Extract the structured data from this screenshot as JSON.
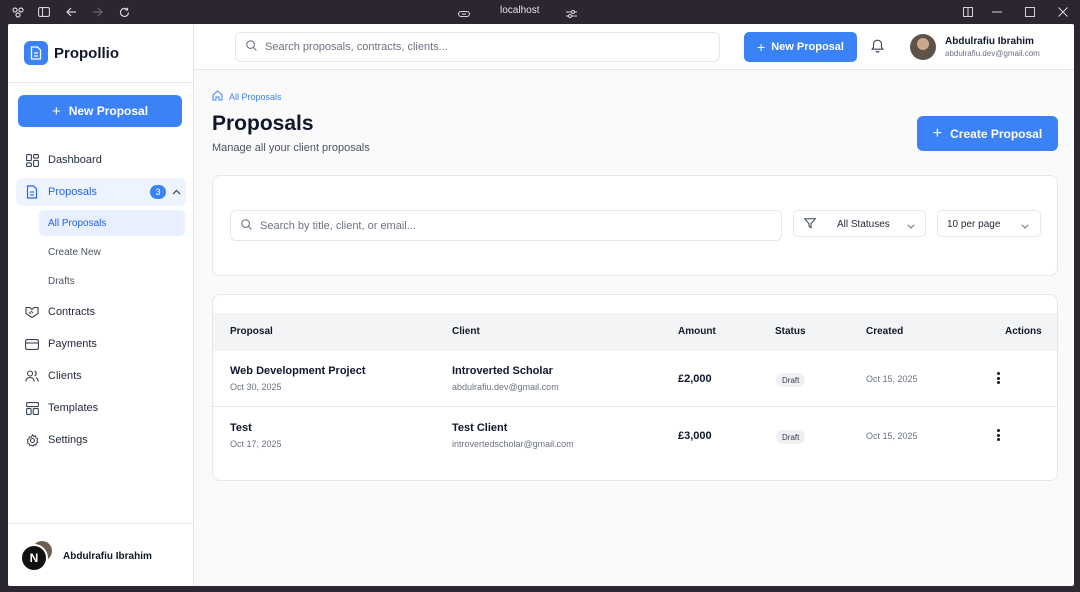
{
  "browser": {
    "url": "localhost"
  },
  "brand": {
    "name": "Propollio",
    "accent": "#3b82f6"
  },
  "sidebar": {
    "new_proposal_label": "New Proposal",
    "items": [
      {
        "label": "Dashboard",
        "icon": "dashboard-icon"
      },
      {
        "label": "Proposals",
        "icon": "document-icon",
        "badge": "3"
      },
      {
        "label": "Contracts",
        "icon": "handshake-icon"
      },
      {
        "label": "Payments",
        "icon": "credit-card-icon"
      },
      {
        "label": "Clients",
        "icon": "users-icon"
      },
      {
        "label": "Templates",
        "icon": "templates-icon"
      },
      {
        "label": "Settings",
        "icon": "gear-icon"
      }
    ],
    "sub_items": [
      {
        "label": "All Proposals"
      },
      {
        "label": "Create New"
      },
      {
        "label": "Drafts"
      }
    ],
    "footer": {
      "user_name": "Abdulrafiu Ibrahim",
      "badge_letter": "N"
    }
  },
  "topbar": {
    "search_placeholder": "Search proposals, contracts, clients...",
    "new_proposal_label": "New Proposal",
    "user_name": "Abdulrafiu Ibrahim",
    "user_email": "abdulrafiu.dev@gmail.com"
  },
  "page": {
    "breadcrumb": "All Proposals",
    "title": "Proposals",
    "subtitle": "Manage all your client proposals",
    "create_label": "Create Proposal"
  },
  "filters": {
    "search_placeholder": "Search by title, client, or email...",
    "status": "All Statuses",
    "per_page": "10 per page"
  },
  "table": {
    "headers": {
      "proposal": "Proposal",
      "client": "Client",
      "amount": "Amount",
      "status": "Status",
      "created": "Created",
      "actions": "Actions"
    },
    "rows": [
      {
        "title": "Web Development Project",
        "date": "Oct 30, 2025",
        "client": "Introverted Scholar",
        "email": "abdulrafiu.dev@gmail.com",
        "amount": "£2,000",
        "status": "Draft",
        "created": "Oct 15, 2025"
      },
      {
        "title": "Test",
        "date": "Oct 17, 2025",
        "client": "Test Client",
        "email": "introvertedscholar@gmail.com",
        "amount": "£3,000",
        "status": "Draft",
        "created": "Oct 15, 2025"
      }
    ]
  }
}
